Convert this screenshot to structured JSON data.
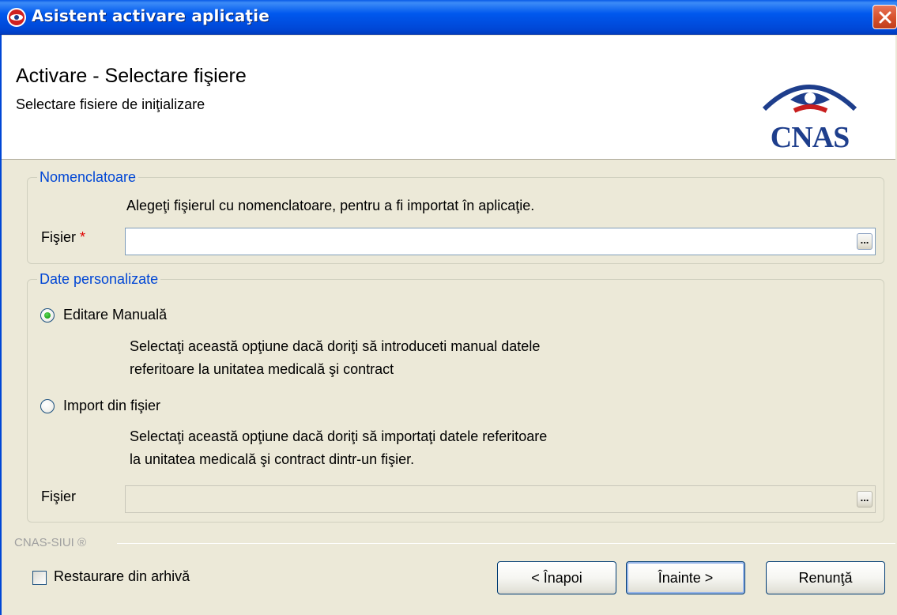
{
  "window": {
    "title": "Asistent activare aplicaţie"
  },
  "header": {
    "title": "Activare - Selectare fişiere",
    "subtitle": "Selectare fisiere de iniţializare",
    "logo_text": "CNAS"
  },
  "nomenclatoare": {
    "legend": "Nomenclatoare",
    "description": "Alegeţi fişierul cu nomenclatoare, pentru a fi importat în aplicaţie.",
    "file_label": "Fişier",
    "required_mark": "*",
    "file_value": "",
    "browse_label": "..."
  },
  "date_personalizate": {
    "legend": "Date personalizate",
    "option_manual": {
      "label": "Editare Manuală",
      "selected": true,
      "desc_line1": "Selectaţi această opţiune dacă doriţi să introduceti manual datele",
      "desc_line2": "referitoare la unitatea medicală şi contract"
    },
    "option_import": {
      "label": "Import din fişier",
      "selected": false,
      "desc_line1": "Selectaţi această opţiune dacă doriţi să importaţi datele referitoare",
      "desc_line2": "la unitatea medicală şi contract dintr-un fişier."
    },
    "file_label": "Fişier",
    "file_value": "",
    "browse_label": "..."
  },
  "footer": {
    "separator_label": "CNAS-SIUI ®",
    "restore_checkbox": {
      "label": "Restaurare din arhivă",
      "checked": false
    },
    "back_button": "< Înapoi",
    "next_button": "Înainte >",
    "cancel_button": "Renunţă"
  },
  "colors": {
    "titlebar": "#0058EE",
    "legend": "#0046D5",
    "required": "#E00000",
    "logo": "#1E3E8C",
    "dialog_bg": "#ECE9D8"
  }
}
